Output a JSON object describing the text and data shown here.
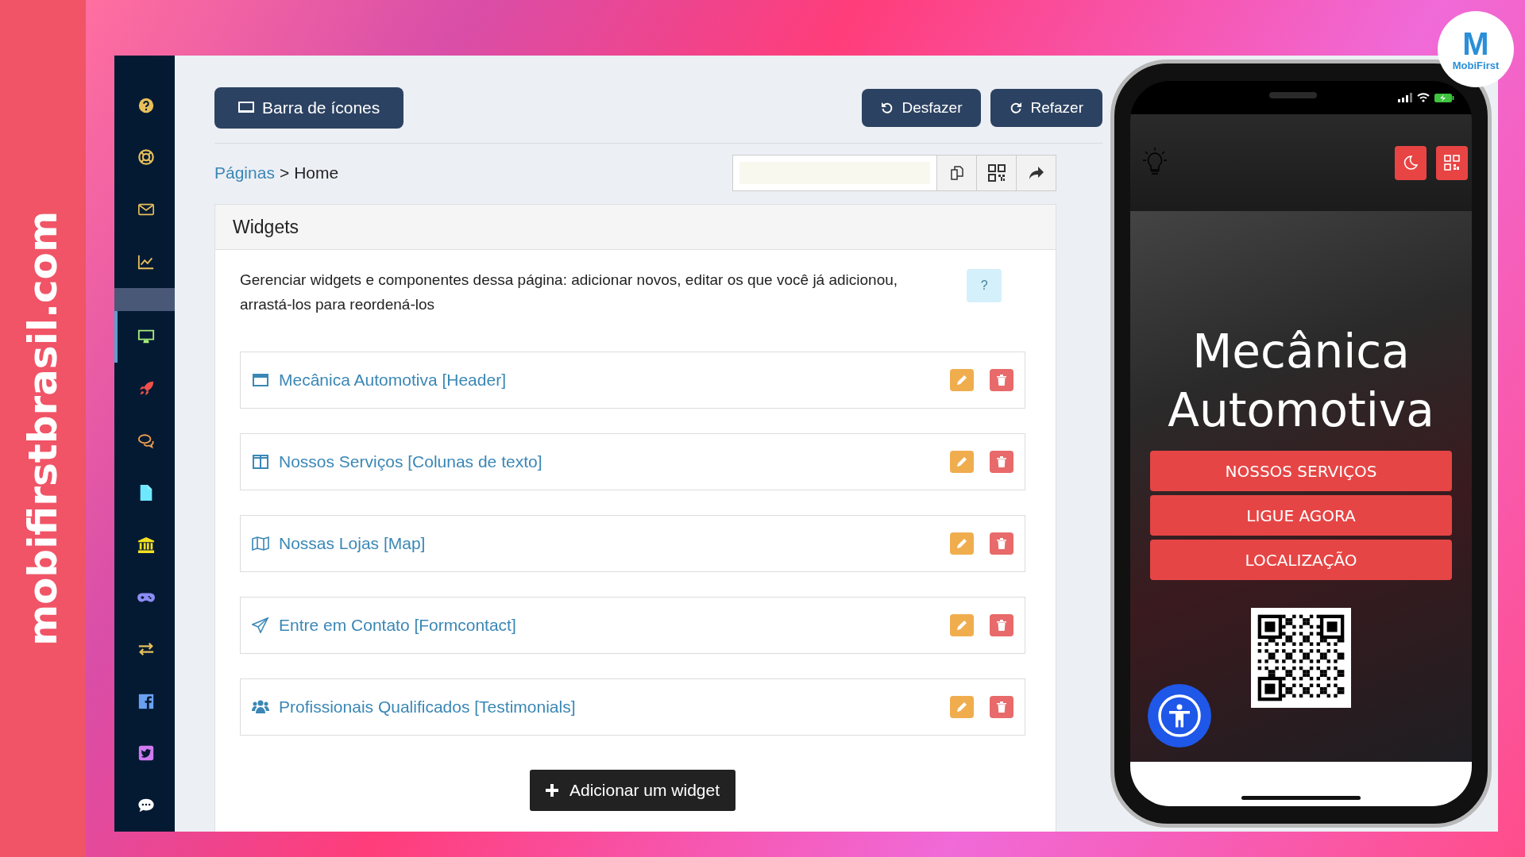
{
  "branding": {
    "side_text": "mobifirstbrasil.com",
    "logo_letter": "M",
    "logo_text": "MobiFirst"
  },
  "sidebar": {
    "items": [
      {
        "kind": "help",
        "selected": false
      },
      {
        "kind": "lifebuoy",
        "selected": false
      },
      {
        "kind": "mail",
        "selected": false
      },
      {
        "kind": "chart",
        "selected": false
      },
      {
        "kind": "monitor",
        "selected": true
      },
      {
        "kind": "rocket",
        "selected": false
      },
      {
        "kind": "chat",
        "selected": false
      },
      {
        "kind": "file",
        "selected": false
      },
      {
        "kind": "bank",
        "selected": false
      },
      {
        "kind": "gamepad",
        "selected": false
      },
      {
        "kind": "exchange",
        "selected": false
      },
      {
        "kind": "facebook",
        "selected": false
      },
      {
        "kind": "twitter",
        "selected": false
      },
      {
        "kind": "comment",
        "selected": false
      }
    ]
  },
  "toolbar": {
    "icon_bar_button": "Barra de ícones",
    "undo_button": "Desfazer",
    "redo_button": "Refazer"
  },
  "breadcrumb": {
    "link": "Páginas",
    "separator": ">",
    "current": "Home"
  },
  "page_tools": [
    {
      "kind": "copy"
    },
    {
      "kind": "qr"
    },
    {
      "kind": "share"
    }
  ],
  "widgets_panel": {
    "title": "Widgets",
    "description": "Gerenciar widgets e componentes dessa página: adicionar novos, editar os que você já adicionou, arrastá-los para reordená-los",
    "help_button": "?",
    "widgets": [
      {
        "kind": "header",
        "title": "Mecânica Automotiva [Header]"
      },
      {
        "kind": "columns",
        "title": "Nossos Serviços [Colunas de texto]"
      },
      {
        "kind": "map",
        "title": "Nossas Lojas [Map]"
      },
      {
        "kind": "send",
        "title": "Entre em Contato [Formcontact]"
      },
      {
        "kind": "users",
        "title": "Profissionais Qualificados [Testimonials]"
      }
    ],
    "add_button": "Adicionar um widget"
  },
  "phone": {
    "title": "Mecânica Automotiva",
    "buttons": [
      "NOSSOS SERVIÇOS",
      "LIGUE AGORA",
      "LOCALIZAÇÃO"
    ]
  }
}
